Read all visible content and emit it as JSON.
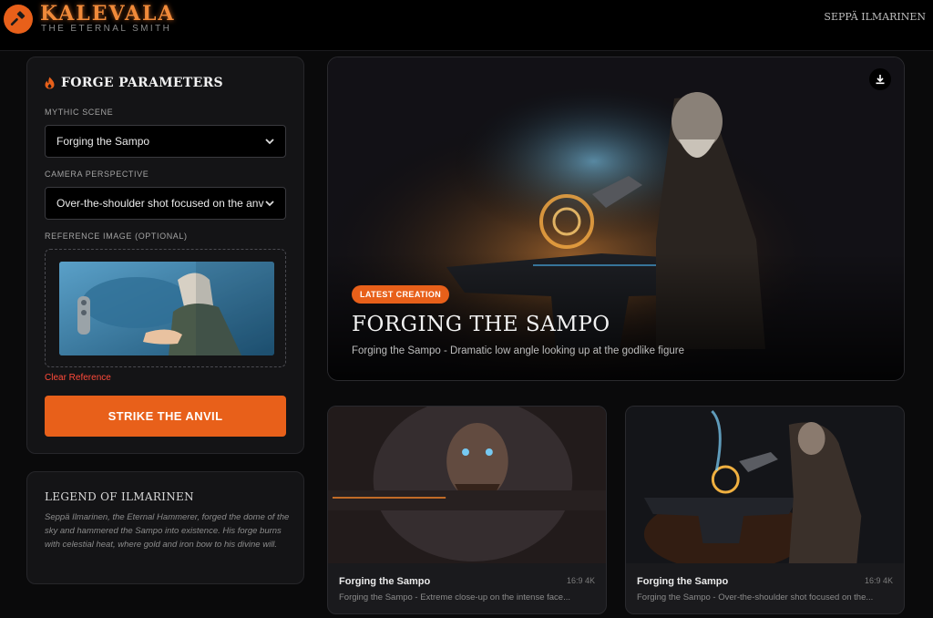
{
  "header": {
    "brand": "KALEVALA",
    "tagline": "THE ETERNAL SMITH",
    "user": "SEPPÄ ILMARINEN"
  },
  "params": {
    "title": "FORGE PARAMETERS",
    "scene_label": "MYTHIC SCENE",
    "scene_value": "Forging the Sampo",
    "camera_label": "CAMERA PERSPECTIVE",
    "camera_value": "Over-the-shoulder shot focused on the anvil",
    "reference_label": "REFERENCE IMAGE (OPTIONAL)",
    "clear_reference": "Clear Reference",
    "strike_button": "STRIKE THE ANVIL"
  },
  "legend": {
    "title": "LEGEND OF ILMARINEN",
    "text": "Seppä Ilmarinen, the Eternal Hammerer, forged the dome of the sky and hammered the Sampo into existence. His forge burns with celestial heat, where gold and iron bow to his divine will."
  },
  "hero": {
    "badge": "LATEST CREATION",
    "title": "FORGING THE SAMPO",
    "description": "Forging the Sampo - Dramatic low angle looking up at the godlike figure"
  },
  "cards": [
    {
      "title": "Forging the Sampo",
      "meta": "16:9 4K",
      "description": "Forging the Sampo - Extreme close-up on the intense face..."
    },
    {
      "title": "Forging the Sampo",
      "meta": "16:9 4K",
      "description": "Forging the Sampo - Over-the-shoulder shot focused on the..."
    }
  ],
  "colors": {
    "accent": "#e8601a",
    "background": "#0a0a0b",
    "panel": "#141416",
    "danger": "#ff4a3a"
  },
  "icons": {
    "logo": "hammer-icon",
    "params": "flame-icon",
    "select": "chevron-down-icon",
    "hero": "download-icon"
  }
}
